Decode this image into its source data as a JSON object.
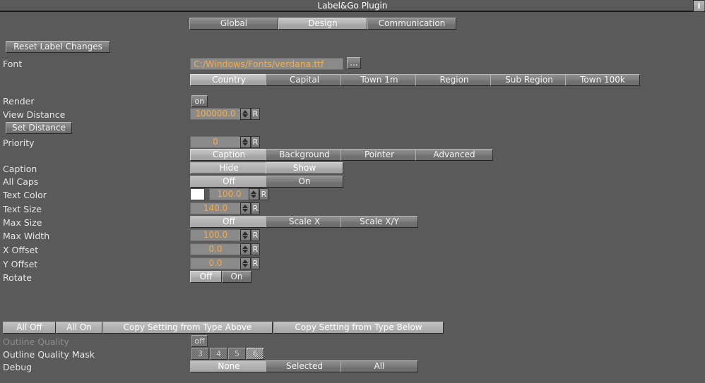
{
  "window": {
    "title": "Label&Go Plugin",
    "info_label": "i"
  },
  "tabs": {
    "items": [
      {
        "label": "Global",
        "selected": false
      },
      {
        "label": "Design",
        "selected": true
      },
      {
        "label": "Communication",
        "selected": false
      }
    ]
  },
  "toolbar": {
    "reset_label": "Reset Label Changes"
  },
  "font_row": {
    "label": "Font",
    "value": "C:/Windows/Fonts/verdana.ttf",
    "browse_label": "..."
  },
  "type_tabs": {
    "items": [
      {
        "label": "Country",
        "selected": true
      },
      {
        "label": "Capital",
        "selected": false
      },
      {
        "label": "Town 1m",
        "selected": false
      },
      {
        "label": "Region",
        "selected": false
      },
      {
        "label": "Sub Region",
        "selected": false
      },
      {
        "label": "Town 100k",
        "selected": false
      }
    ]
  },
  "render_row": {
    "label": "Render",
    "value": "on"
  },
  "view_distance_row": {
    "label": "View Distance",
    "value": "100000.0",
    "reset_label": "R"
  },
  "set_distance": {
    "label": "Set Distance"
  },
  "priority_row": {
    "label": "Priority",
    "value": "0",
    "reset_label": "R"
  },
  "section_tabs": {
    "items": [
      {
        "label": "Caption",
        "selected": true
      },
      {
        "label": "Background",
        "selected": false
      },
      {
        "label": "Pointer",
        "selected": false
      },
      {
        "label": "Advanced",
        "selected": false
      }
    ]
  },
  "caption_row": {
    "label": "Caption",
    "options": [
      {
        "label": "Hide",
        "selected": false
      },
      {
        "label": "Show",
        "selected": true
      }
    ]
  },
  "all_caps_row": {
    "label": "All Caps",
    "options": [
      {
        "label": "Off",
        "selected": false
      },
      {
        "label": "On",
        "selected": false
      }
    ]
  },
  "text_color_row": {
    "label": "Text Color",
    "swatch_color": "#ffffff",
    "value": "100.0",
    "reset_label": "R"
  },
  "text_size_row": {
    "label": "Text Size",
    "value": "140.0",
    "reset_label": "R"
  },
  "max_size_row": {
    "label": "Max Size",
    "options": [
      {
        "label": "Off",
        "selected": false
      },
      {
        "label": "Scale X",
        "selected": false
      },
      {
        "label": "Scale X/Y",
        "selected": false
      }
    ]
  },
  "max_width_row": {
    "label": "Max Width",
    "value": "100.0",
    "reset_label": "R"
  },
  "x_offset_row": {
    "label": "X Offset",
    "value": "0.0",
    "reset_label": "R"
  },
  "y_offset_row": {
    "label": "Y Offset",
    "value": "0.0",
    "reset_label": "R"
  },
  "rotate_row": {
    "label": "Rotate",
    "options": [
      {
        "label": "Off",
        "selected": true
      },
      {
        "label": "On",
        "selected": false
      }
    ]
  },
  "bottom_actions": {
    "items": [
      {
        "label": "All Off"
      },
      {
        "label": "All On"
      },
      {
        "label": "Copy Setting from Type Above"
      },
      {
        "label": "Copy Setting from Type Below"
      }
    ]
  },
  "outline_quality_row": {
    "label": "Outline Quality",
    "value": "off",
    "disabled": true
  },
  "outline_quality_mask_row": {
    "label": "Outline Quality Mask",
    "options": [
      {
        "label": "3",
        "selected": false
      },
      {
        "label": "4",
        "selected": false
      },
      {
        "label": "5",
        "selected": false
      },
      {
        "label": "6",
        "selected": true
      }
    ]
  },
  "debug_row": {
    "label": "Debug",
    "options": [
      {
        "label": "None",
        "selected": true
      },
      {
        "label": "Selected",
        "selected": false
      },
      {
        "label": "All",
        "selected": false
      }
    ]
  },
  "theme": {
    "background": "#5a5a5a",
    "accent_text": "#f0ad4e",
    "button_face": "#7d7d7d",
    "button_selected": "#b4b4b4"
  }
}
